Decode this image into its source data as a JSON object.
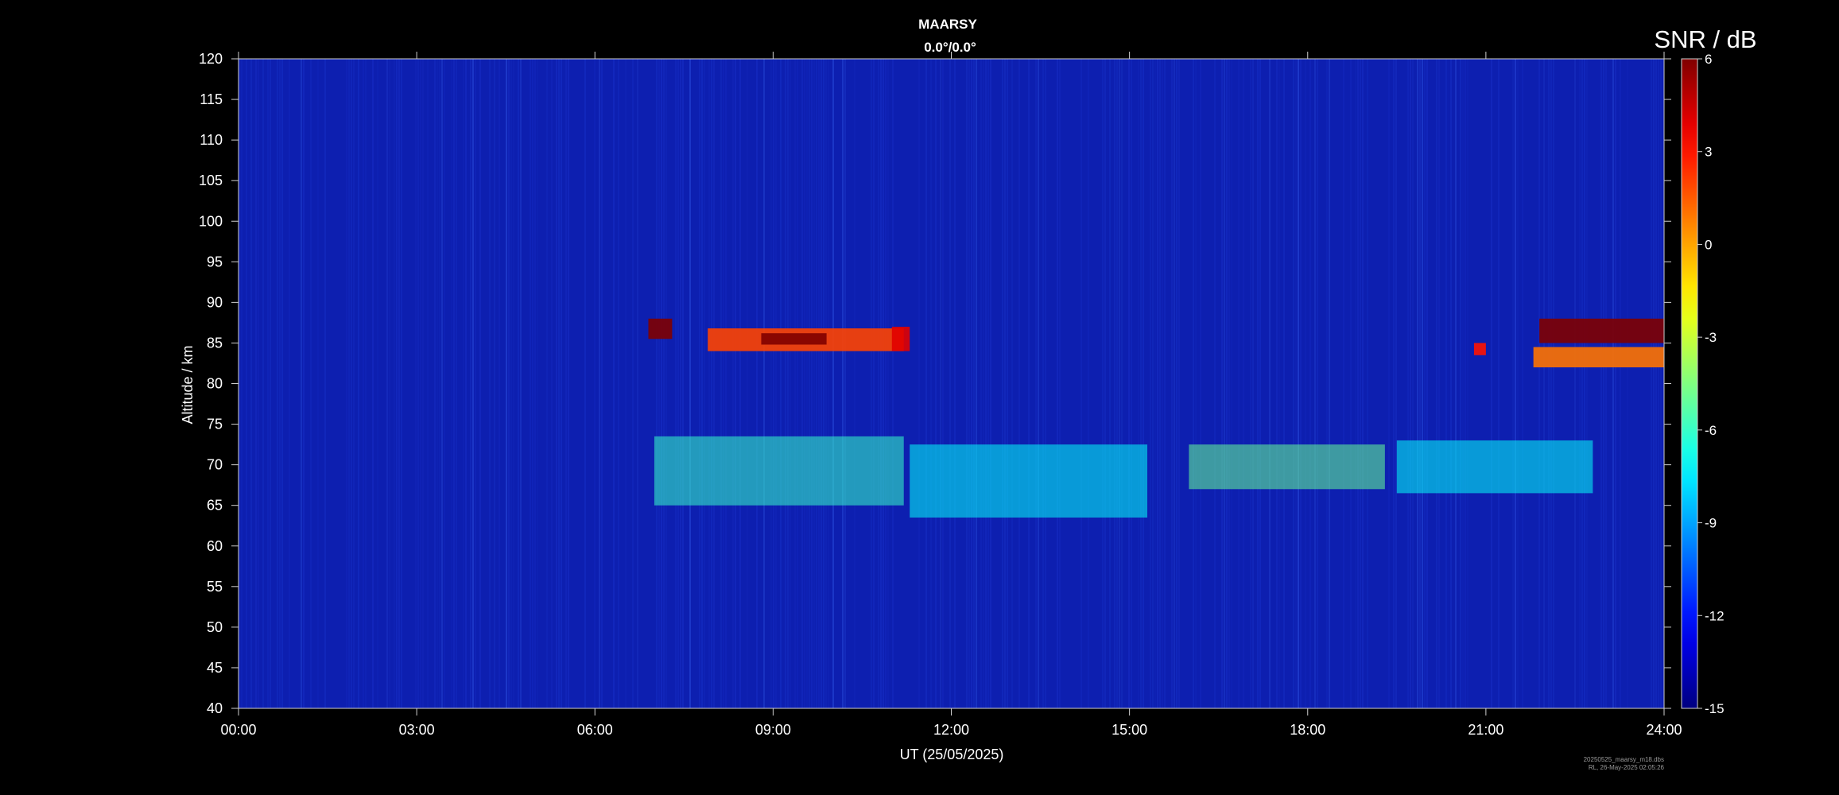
{
  "chart_data": {
    "type": "heatmap",
    "title": "MAARSY",
    "subtitle": "0.0°/0.0°",
    "xlabel": "UT (25/05/2025)",
    "ylabel": "Altitude / km",
    "x_range_hours": [
      0,
      24
    ],
    "x_ticks": [
      "00:00",
      "03:00",
      "06:00",
      "09:00",
      "12:00",
      "15:00",
      "18:00",
      "21:00",
      "24:00"
    ],
    "ylim": [
      40,
      120
    ],
    "y_ticks": [
      40,
      45,
      50,
      55,
      60,
      65,
      70,
      75,
      80,
      85,
      90,
      95,
      100,
      105,
      110,
      115,
      120
    ],
    "grid": false,
    "background_color": "#0d1fb0",
    "colorbar": {
      "title": "SNR / dB",
      "range": [
        -15,
        6
      ],
      "ticks": [
        6,
        3,
        0,
        -3,
        -6,
        -9,
        -12,
        -15
      ],
      "colormap": "jet"
    },
    "echo_regions": [
      {
        "t_start": 6.9,
        "t_end": 7.3,
        "alt_low": 85.5,
        "alt_high": 88.0,
        "snr_db": 6
      },
      {
        "t_start": 7.9,
        "t_end": 11.2,
        "alt_low": 84.0,
        "alt_high": 86.8,
        "snr_db": 2
      },
      {
        "t_start": 8.8,
        "t_end": 9.9,
        "alt_low": 84.8,
        "alt_high": 86.2,
        "snr_db": 6
      },
      {
        "t_start": 11.0,
        "t_end": 11.3,
        "alt_low": 84.0,
        "alt_high": 87.0,
        "snr_db": 4
      },
      {
        "t_start": 20.8,
        "t_end": 21.0,
        "alt_low": 83.5,
        "alt_high": 85.0,
        "snr_db": 3
      },
      {
        "t_start": 21.9,
        "t_end": 24.0,
        "alt_low": 85.0,
        "alt_high": 88.0,
        "snr_db": 6
      },
      {
        "t_start": 21.8,
        "t_end": 24.0,
        "alt_low": 82.0,
        "alt_high": 84.5,
        "snr_db": 1
      },
      {
        "t_start": 7.0,
        "t_end": 11.2,
        "alt_low": 65.0,
        "alt_high": 73.5,
        "snr_db": -6
      },
      {
        "t_start": 11.3,
        "t_end": 15.3,
        "alt_low": 63.5,
        "alt_high": 72.5,
        "snr_db": -7
      },
      {
        "t_start": 16.0,
        "t_end": 19.3,
        "alt_low": 67.0,
        "alt_high": 72.5,
        "snr_db": -5
      },
      {
        "t_start": 19.5,
        "t_end": 22.8,
        "alt_low": 66.5,
        "alt_high": 73.0,
        "snr_db": -7
      }
    ]
  },
  "footer": {
    "file": "20250525_maarsy_m18.dbs",
    "processed": "RL, 26-May-2025 02:05:26"
  }
}
